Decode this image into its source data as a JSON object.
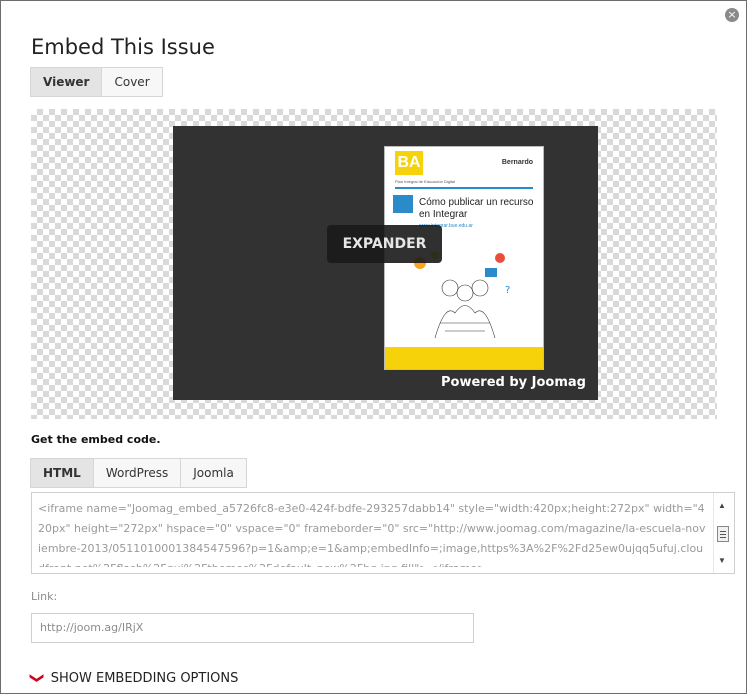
{
  "dialog": {
    "title": "Embed This Issue",
    "close_glyph": "×"
  },
  "view_tabs": [
    {
      "label": "Viewer",
      "active": true
    },
    {
      "label": "Cover",
      "active": false
    }
  ],
  "preview": {
    "expander_label": "EXPANDER",
    "powered_label": "Powered by Joomag",
    "cover": {
      "logo": "BA",
      "brand": "Bernardo",
      "subtitle": "Plan Integral de Educación Digital",
      "headline": "Cómo publicar un recurso en Integrar",
      "url": "www.integrar.bue.edu.ar"
    }
  },
  "embed": {
    "heading": "Get the embed code.",
    "tabs": [
      {
        "label": "HTML",
        "active": true
      },
      {
        "label": "WordPress",
        "active": false
      },
      {
        "label": "Joomla",
        "active": false
      }
    ],
    "code": "<iframe name=\"Joomag_embed_a5726fc8-e3e0-424f-bdfe-293257dabb14\" style=\"width:420px;height:272px\" width=\"420px\" height=\"272px\" hspace=\"0\" vspace=\"0\" frameborder=\"0\" src=\"http://www.joomag.com/magazine/la-escuela-noviembre-2013/0511010001384547596?p=1&amp;e=1&amp;embedInfo=;image,https%3A%2F%2Fd25ew0ujqq5ufuj.cloudfront.net%2Fflash%2Fgui%2Fthemes%2Fdefault_new%2Fbg.jpg,fill\"></iframe>"
  },
  "link": {
    "label": "Link:",
    "value": "http://joom.ag/IRjX"
  },
  "options": {
    "label": "SHOW EMBEDDING OPTIONS",
    "chevron": "❯"
  },
  "colors": {
    "accent": "#d0021b",
    "viewer_bg": "#323232",
    "cover_yellow": "#f5d20a"
  }
}
